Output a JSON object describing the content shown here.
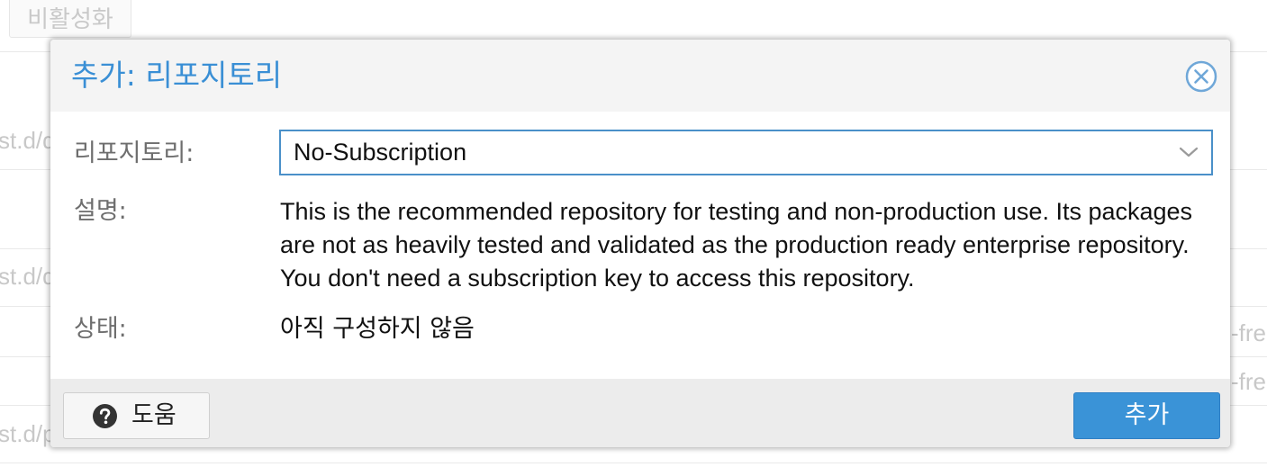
{
  "background": {
    "disable_button_label": "비활성화",
    "row_snippets": [
      "st.d/d",
      "st.d/d",
      "st.d/p"
    ],
    "right_snippets": [
      "-fre",
      "-fre"
    ]
  },
  "dialog": {
    "title": "추가: 리포지토리",
    "fields": {
      "repository_label": "리포지토리:",
      "repository_value": "No-Subscription",
      "description_label": "설명:",
      "description_text": "This is the recommended repository for testing and non-production use. Its packages are not as heavily tested and validated as the production ready enterprise repository. You don't need a subscription key to access this repository.",
      "status_label": "상태:",
      "status_value": "아직 구성하지 않음"
    },
    "footer": {
      "help_label": "도움",
      "add_label": "추가"
    }
  },
  "icons": {
    "close": "close-circle-icon",
    "dropdown": "chevron-down-icon",
    "help": "question-circle-icon"
  },
  "colors": {
    "accent": "#3a8fd5",
    "primary_button": "#3a93d7",
    "header_bg": "#f4f4f4",
    "footer_bg": "#ececec"
  }
}
